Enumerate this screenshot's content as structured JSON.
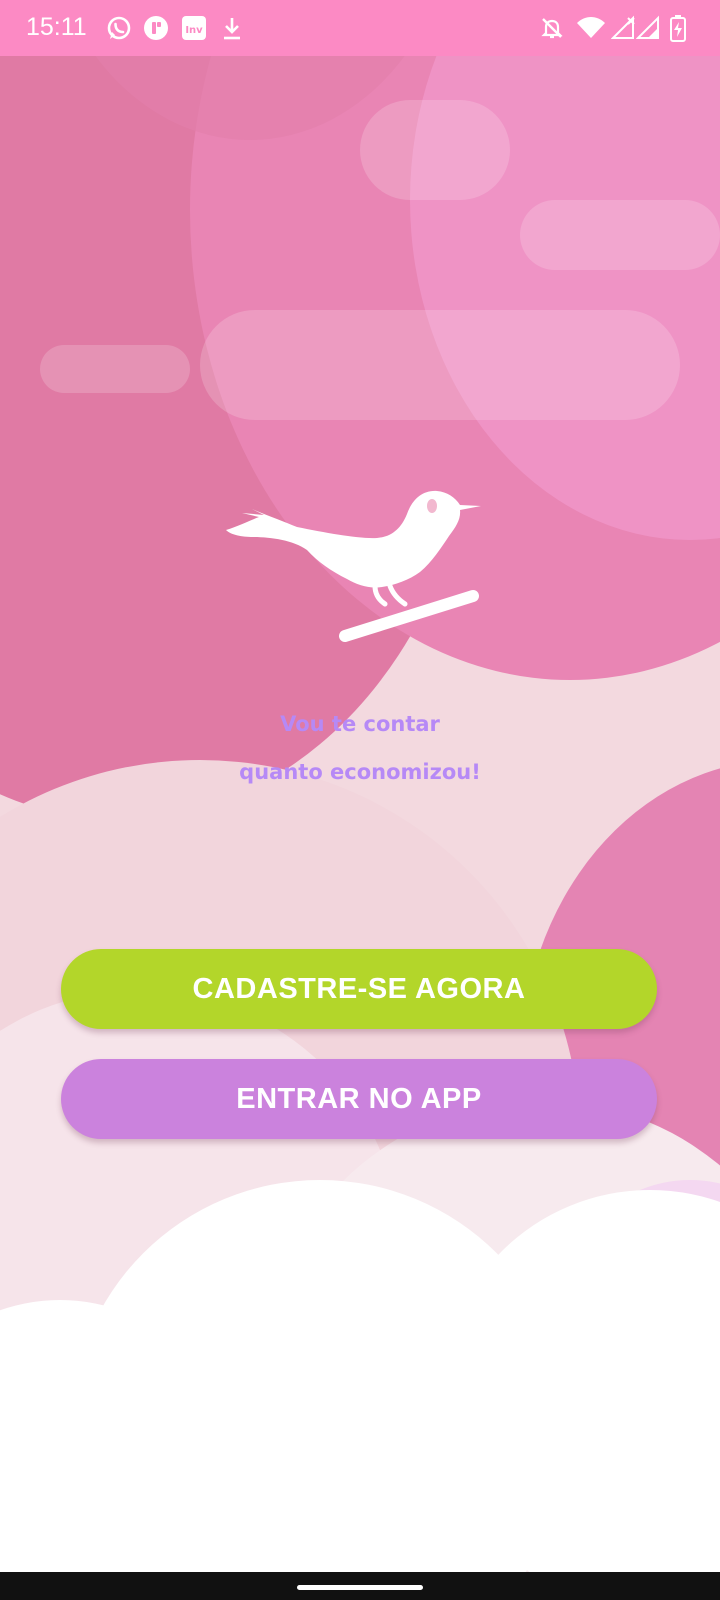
{
  "status_bar": {
    "time": "15:11",
    "notification_icons": [
      "whatsapp-icon",
      "app-badge-icon",
      "inv-app-icon",
      "download-icon"
    ],
    "inv_label": "Inv",
    "system_icons": [
      "notifications-muted-icon",
      "wifi-icon",
      "cellular-no-signal-icon",
      "cellular-signal-icon",
      "battery-charging-icon"
    ]
  },
  "colors": {
    "status_bar": "#fc8ac4",
    "primary_button": "#b3d62a",
    "secondary_button": "#cb82dd",
    "tagline": "#b689f6"
  },
  "hero": {
    "logo_icon": "bird-on-branch-logo",
    "tagline_line1": "Vou te contar",
    "tagline_line2": "quanto economizou!"
  },
  "actions": {
    "signup_label": "CADASTRE-SE AGORA",
    "login_label": "ENTRAR NO APP"
  }
}
